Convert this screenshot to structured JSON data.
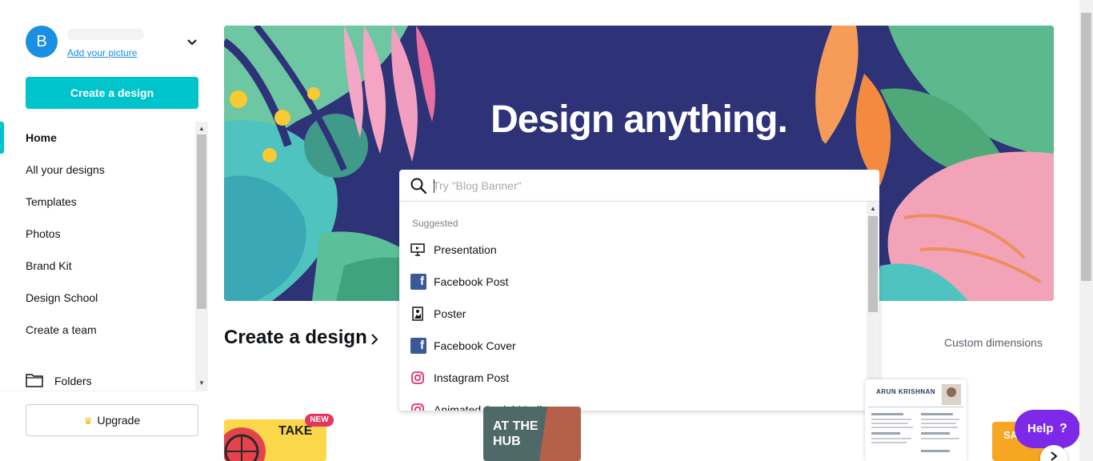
{
  "profile": {
    "avatar_letter": "B",
    "add_picture_link": "Add your picture"
  },
  "sidebar": {
    "create_button": "Create a design",
    "items": [
      {
        "label": "Home",
        "active": true
      },
      {
        "label": "All your designs"
      },
      {
        "label": "Templates"
      },
      {
        "label": "Photos"
      },
      {
        "label": "Brand Kit"
      },
      {
        "label": "Design School"
      },
      {
        "label": "Create a team"
      }
    ],
    "folders_label": "Folders",
    "upgrade_label": "Upgrade"
  },
  "hero": {
    "title": "Design anything."
  },
  "search": {
    "placeholder": "Try \"Blog Banner\"",
    "value": ""
  },
  "dropdown": {
    "heading": "Suggested",
    "items": [
      {
        "label": "Presentation",
        "icon": "presentation-icon"
      },
      {
        "label": "Facebook Post",
        "icon": "facebook-icon"
      },
      {
        "label": "Poster",
        "icon": "poster-icon"
      },
      {
        "label": "Facebook Cover",
        "icon": "facebook-icon"
      },
      {
        "label": "Instagram Post",
        "icon": "instagram-icon"
      },
      {
        "label": "Animated Social Media",
        "icon": "instagram-icon"
      }
    ]
  },
  "main": {
    "section_title": "Create a design",
    "custom_dimensions": "Custom dimensions",
    "cards": {
      "new_badge": "NEW",
      "card1_text": "TAKE",
      "card2_line1": "AT THE",
      "card2_line2": "HUB",
      "card3_name": "ARUN KRISHNAN",
      "card4_text": "SA"
    }
  },
  "help": {
    "label": "Help",
    "q": "?"
  },
  "colors": {
    "accent": "#00c4cc",
    "hero_bg": "#2e3277",
    "help": "#7d2ae8",
    "avatar": "#1a8fe3"
  }
}
